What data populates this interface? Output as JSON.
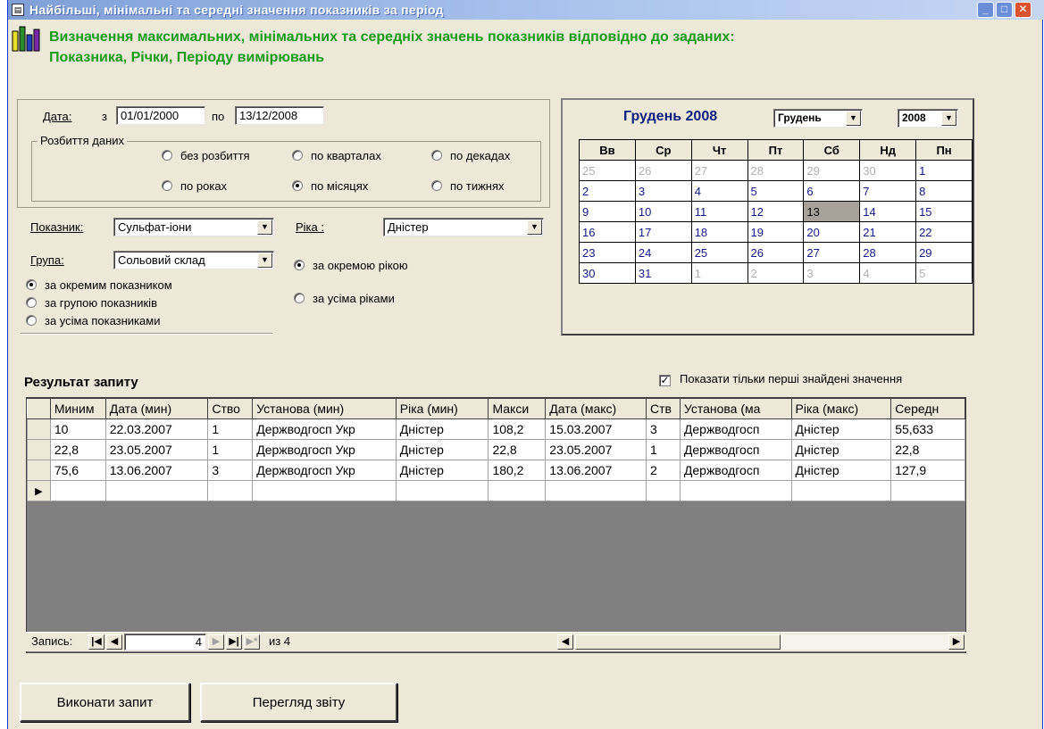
{
  "window": {
    "title": "Найбільші, мінімальні та середні значення показників за період"
  },
  "header": {
    "line1": "Визначення максимальних, мінімальних та середніх значень показників відповідно до заданих:",
    "line2": "Показника, Річки, Періоду вимірювань"
  },
  "date": {
    "label": "Дата:",
    "from_label": "з",
    "from_value": "01/01/2000",
    "to_label": "по",
    "to_value": "13/12/2008"
  },
  "breakdown": {
    "label": "Розбиття даних",
    "options": [
      {
        "label": "без розбиття",
        "checked": false
      },
      {
        "label": "по кварталах",
        "checked": false
      },
      {
        "label": "по декадах",
        "checked": false
      },
      {
        "label": "по роках",
        "checked": false
      },
      {
        "label": "по місяцях",
        "checked": true
      },
      {
        "label": "по тижнях",
        "checked": false
      }
    ]
  },
  "indicator": {
    "label": "Показник:",
    "value": "Сульфат-іони",
    "group_label": "Група:",
    "group_value": "Сольовий склад",
    "modes": [
      {
        "label": "за окремим показником",
        "checked": true
      },
      {
        "label": "за групою показників",
        "checked": false
      },
      {
        "label": "за усіма показниками",
        "checked": false
      }
    ]
  },
  "river": {
    "label": "Ріка :",
    "value": "Дністер",
    "modes": [
      {
        "label": "за окремою рікою",
        "checked": true
      },
      {
        "label": "за усіма ріками",
        "checked": false
      }
    ]
  },
  "calendar": {
    "title": "Грудень 2008",
    "month": "Грудень",
    "year": "2008",
    "weekdays": [
      "Вв",
      "Ср",
      "Чт",
      "Пт",
      "Сб",
      "Нд",
      "Пн"
    ],
    "weeks": [
      [
        "25",
        "26",
        "27",
        "28",
        "29",
        "30",
        "1"
      ],
      [
        "2",
        "3",
        "4",
        "5",
        "6",
        "7",
        "8"
      ],
      [
        "9",
        "10",
        "11",
        "12",
        "13",
        "14",
        "15"
      ],
      [
        "16",
        "17",
        "18",
        "19",
        "20",
        "21",
        "22"
      ],
      [
        "23",
        "24",
        "25",
        "26",
        "27",
        "28",
        "29"
      ],
      [
        "30",
        "31",
        "1",
        "2",
        "3",
        "4",
        "5"
      ]
    ],
    "selected_day": "13"
  },
  "results": {
    "title": "Результат запиту",
    "show_first_only_label": "Показати тільки перші знайдені значення",
    "show_first_only": true,
    "columns": [
      "Миним",
      "Дата (мин)",
      "Ство",
      "Установа (мин)",
      "Ріка (мин)",
      "Макси",
      "Дата (макс)",
      "Ств",
      "Установа (ма",
      "Ріка (макс)",
      "Середн"
    ],
    "rows": [
      [
        "10",
        "22.03.2007",
        "1",
        "Держводгосп Укр",
        "Дністер",
        "108,2",
        "15.03.2007",
        "3",
        "Держводгосп",
        "Дністер",
        "55,633"
      ],
      [
        "22,8",
        "23.05.2007",
        "1",
        "Держводгосп Укр",
        "Дністер",
        "22,8",
        "23.05.2007",
        "1",
        "Держводгосп",
        "Дністер",
        "22,8"
      ],
      [
        "75,6",
        "13.06.2007",
        "3",
        "Держводгосп Укр",
        "Дністер",
        "180,2",
        "13.06.2007",
        "2",
        "Держводгосп",
        "Дністер",
        "127,9"
      ]
    ]
  },
  "navigation": {
    "record_label": "Запись:",
    "current": "4",
    "of_label": "из 4"
  },
  "buttons": {
    "run_query": "Виконати запит",
    "view_report": "Перегляд звіту"
  }
}
